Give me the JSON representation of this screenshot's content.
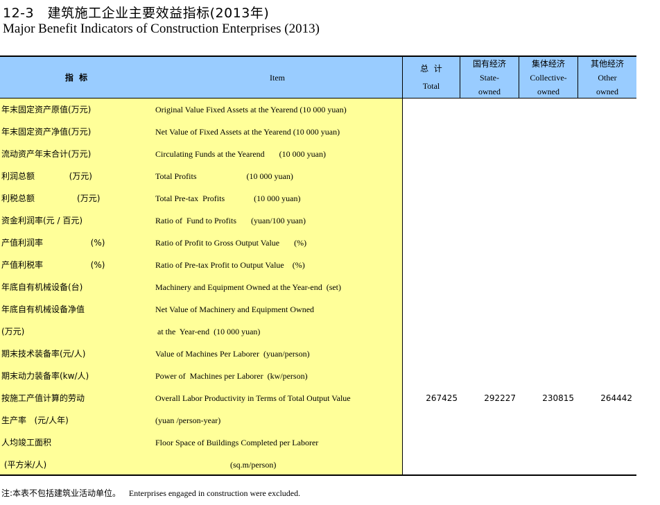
{
  "title": {
    "cn": "12-3　建筑施工企业主要效益指标(2013年)",
    "en": "Major Benefit Indicators of Construction Enterprises (2013)"
  },
  "header": {
    "indicator_cn": "指  标",
    "item_en": "Item",
    "total": {
      "cn": "总  计",
      "en": "Total"
    },
    "state": {
      "cn": "国有经济",
      "en1": "State-",
      "en2": "owned"
    },
    "collective": {
      "cn": "集体经济",
      "en1": "Collective-",
      "en2": "owned"
    },
    "other": {
      "cn": "其他经济",
      "en1": "Other",
      "en2": "owned"
    }
  },
  "rows": [
    {
      "cn": "年末固定资产原值(万元)",
      "en": "Original Value Fixed Assets at the Yearend (10 000 yuan)",
      "total": "",
      "state": "",
      "collective": "",
      "other": ""
    },
    {
      "cn": "年末固定资产净值(万元)",
      "en": "Net Value of Fixed Assets at the Yearend (10 000 yuan)",
      "total": "",
      "state": "",
      "collective": "",
      "other": ""
    },
    {
      "cn": "流动资产年末合计(万元)",
      "en": "Circulating Funds at the Yearend       (10 000 yuan)",
      "total": "",
      "state": "",
      "collective": "",
      "other": ""
    },
    {
      "cn": "利润总额             (万元)",
      "en": "Total Profits                        (10 000 yuan)",
      "total": "",
      "state": "",
      "collective": "",
      "other": ""
    },
    {
      "cn": "利税总额                (万元)",
      "en": "Total Pre-tax  Profits              (10 000 yuan)",
      "total": "",
      "state": "",
      "collective": "",
      "other": ""
    },
    {
      "cn": "资金利润率(元 / 百元)",
      "en": "Ratio of  Fund to Profits       (yuan/100 yuan)",
      "total": "",
      "state": "",
      "collective": "",
      "other": ""
    },
    {
      "cn": "产值利润率                  (%)",
      "en": "Ratio of Profit to Gross Output Value       (%)",
      "total": "",
      "state": "",
      "collective": "",
      "other": ""
    },
    {
      "cn": "产值利税率                  (%)",
      "en": "Ratio of Pre-tax Profit to Output Value    (%)",
      "total": "",
      "state": "",
      "collective": "",
      "other": ""
    },
    {
      "cn": "年底自有机械设备(台)",
      "en": "Machinery and Equipment Owned at the Year-end  (set)",
      "total": "",
      "state": "",
      "collective": "",
      "other": ""
    },
    {
      "cn": "年底自有机械设备净值",
      "en": "Net Value of Machinery and Equipment Owned",
      "total": "",
      "state": "",
      "collective": "",
      "other": ""
    },
    {
      "cn": "(万元)",
      "en": " at the  Year-end  (10 000 yuan)",
      "total": "",
      "state": "",
      "collective": "",
      "other": ""
    },
    {
      "cn": "期末技术装备率(元/人)",
      "en": "Value of Machines Per Laborer  (yuan/person)",
      "total": "",
      "state": "",
      "collective": "",
      "other": ""
    },
    {
      "cn": "期末动力装备率(kw/人)",
      "en": "Power of  Machines per Laborer  (kw/person)",
      "total": "",
      "state": "",
      "collective": "",
      "other": ""
    },
    {
      "cn": "按施工产值计算的劳动",
      "en": "Overall Labor Productivity in Terms of Total Output Value",
      "total": "267425",
      "state": "292227",
      "collective": "230815",
      "other": "264442"
    },
    {
      "cn": "生产率   (元/人年)",
      "en": "(yuan /person-year)",
      "total": "",
      "state": "",
      "collective": "",
      "other": ""
    },
    {
      "cn": "人均竣工面积",
      "en": "Floor Space of Buildings Completed per Laborer",
      "total": "",
      "state": "",
      "collective": "",
      "other": ""
    },
    {
      "cn": " (平方米/人)",
      "en": "                                    (sq.m/person)",
      "total": "",
      "state": "",
      "collective": "",
      "other": ""
    }
  ],
  "note": {
    "cn": "注:本表不包括建筑业活动单位。",
    "en": "Enterprises engaged in construction were excluded."
  }
}
